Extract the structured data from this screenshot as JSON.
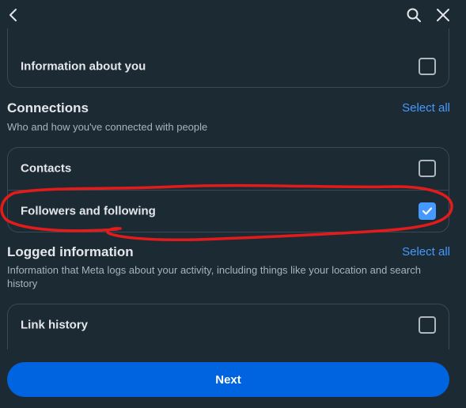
{
  "header": {
    "back_icon": "chevron-left-icon",
    "search_icon": "search-icon",
    "close_icon": "close-icon"
  },
  "top_section": {
    "items": [
      {
        "label": "Information about you",
        "checked": false
      }
    ]
  },
  "connections": {
    "title": "Connections",
    "select_all": "Select all",
    "description": "Who and how you've connected with people",
    "items": [
      {
        "label": "Contacts",
        "checked": false
      },
      {
        "label": "Followers and following",
        "checked": true
      }
    ]
  },
  "logged_information": {
    "title": "Logged information",
    "select_all": "Select all",
    "description": "Information that Meta logs about your activity, including things like your location and search history",
    "items": [
      {
        "label": "Link history",
        "checked": false
      }
    ]
  },
  "footer": {
    "next_label": "Next"
  },
  "colors": {
    "background": "#1c2b33",
    "accent": "#4599ff",
    "button": "#0064e0",
    "annotation": "#e31b1b"
  }
}
